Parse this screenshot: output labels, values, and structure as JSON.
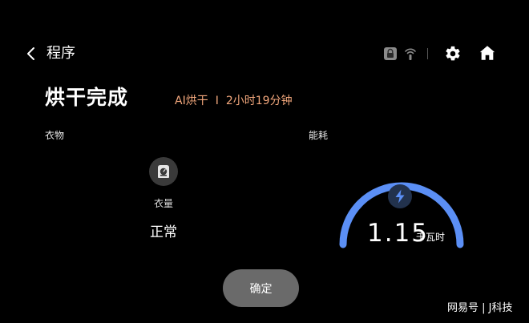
{
  "header": {
    "back_label": "程序",
    "icons": [
      "chevron-left-icon",
      "lock-icon",
      "wifi-icon",
      "gear-icon",
      "home-icon"
    ]
  },
  "status": {
    "title": "烘干完成",
    "mode": "AI烘干",
    "separator": "I",
    "duration": "2小时19分钟"
  },
  "clothes": {
    "section_label": "衣物",
    "load_label": "衣量",
    "load_value": "正常"
  },
  "energy": {
    "section_label": "能耗",
    "value": "1.15",
    "unit": "千瓦时",
    "gauge_color": "#5b8ff5"
  },
  "actions": {
    "confirm_label": "确定"
  },
  "watermark": {
    "text": "网易号 | J科技"
  }
}
